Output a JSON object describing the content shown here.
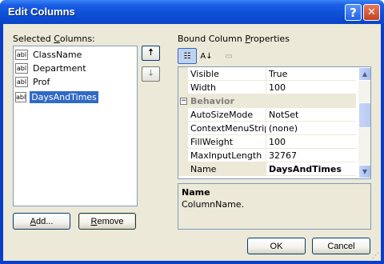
{
  "window": {
    "title": "Edit Columns",
    "help_glyph": "?",
    "close_glyph": "✕"
  },
  "left": {
    "label_prefix": "Selected ",
    "label_mnemonic": "C",
    "label_suffix": "olumns:",
    "items": [
      {
        "icon": "abl",
        "label": "ClassName",
        "selected": false
      },
      {
        "icon": "abl",
        "label": "Department",
        "selected": false
      },
      {
        "icon": "abl",
        "label": "Prof",
        "selected": false
      },
      {
        "icon": "abl",
        "label": "DaysAndTimes",
        "selected": true
      }
    ],
    "move_up_glyph": "🠅",
    "move_down_glyph": "🠇",
    "add_label_mnemonic": "A",
    "add_label_rest": "dd...",
    "remove_label_mnemonic": "R",
    "remove_label_rest": "emove"
  },
  "right": {
    "label_prefix": "Bound Column ",
    "label_mnemonic": "P",
    "label_suffix": "roperties",
    "toolbar": {
      "categorized_glyph": "☷",
      "alphabetical_glyph": "A↓",
      "pages_glyph": "▭"
    },
    "rows": [
      {
        "type": "prop",
        "name": "Visible",
        "value": "True",
        "bold": false
      },
      {
        "type": "prop",
        "name": "Width",
        "value": "100",
        "bold": false
      },
      {
        "type": "category",
        "name": "Behavior",
        "toggle": "−"
      },
      {
        "type": "prop",
        "name": "AutoSizeMode",
        "value": "NotSet",
        "bold": false
      },
      {
        "type": "prop",
        "name": "ContextMenuStrip",
        "value": "(none)",
        "bold": false
      },
      {
        "type": "prop",
        "name": "FillWeight",
        "value": "100",
        "bold": false
      },
      {
        "type": "prop",
        "name": "MaxInputLength",
        "value": "32767",
        "bold": false
      },
      {
        "type": "prop",
        "name": "Name",
        "value": "DaysAndTimes",
        "bold": true,
        "selected": true
      }
    ],
    "scroll_up_glyph": "▲",
    "scroll_down_glyph": "▼",
    "description": {
      "title": "Name",
      "text": "ColumnName."
    }
  },
  "footer": {
    "ok_label": "OK",
    "cancel_label": "Cancel"
  }
}
